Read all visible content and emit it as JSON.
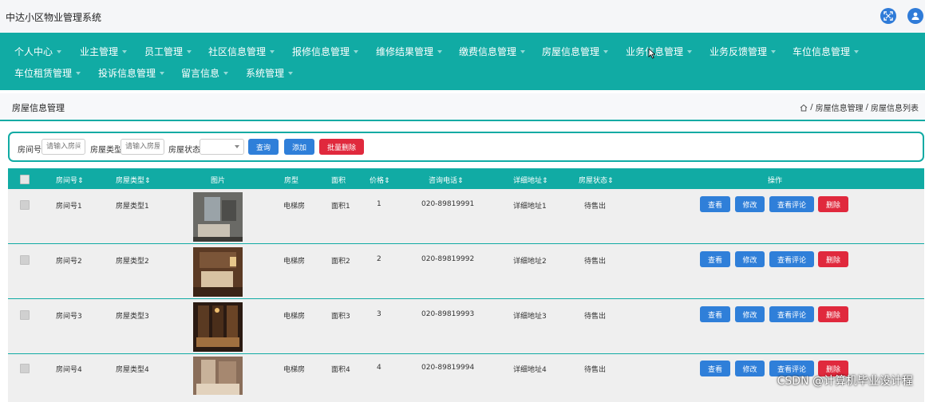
{
  "app": {
    "title": "中达小区物业管理系统"
  },
  "nav": {
    "row1": [
      "个人中心",
      "业主管理",
      "员工管理",
      "社区信息管理",
      "报修信息管理",
      "维修结果管理",
      "缴费信息管理",
      "房屋信息管理",
      "业务信息管理",
      "业务反馈管理",
      "车位信息管理"
    ],
    "row2": [
      "车位租赁管理",
      "投诉信息管理",
      "留言信息",
      "系统管理"
    ]
  },
  "page": {
    "title": "房屋信息管理",
    "breadcrumb": [
      "房屋信息管理",
      "房屋信息列表"
    ]
  },
  "search": {
    "room_label": "房间号",
    "room_placeholder": "请输入房间号",
    "type_label": "房屋类型",
    "type_placeholder": "请输入房屋类型",
    "status_label": "房屋状态",
    "query_btn": "查询",
    "add_btn": "添加",
    "batch_delete_btn": "批量删除"
  },
  "table": {
    "headers": [
      "房间号",
      "房屋类型",
      "图片",
      "房型",
      "面积",
      "价格",
      "咨询电话",
      "详细地址",
      "房屋状态",
      "操作"
    ],
    "sortable": [
      "房间号",
      "房屋类型",
      "价格",
      "咨询电话",
      "详细地址",
      "房屋状态"
    ],
    "rows": [
      {
        "room": "房间号1",
        "type": "房屋类型1",
        "layout": "电梯房",
        "area": "面积1",
        "price": "1",
        "phone": "020-89819991",
        "address": "详细地址1",
        "status": "待售出"
      },
      {
        "room": "房间号2",
        "type": "房屋类型2",
        "layout": "电梯房",
        "area": "面积2",
        "price": "2",
        "phone": "020-89819992",
        "address": "详细地址2",
        "status": "待售出"
      },
      {
        "room": "房间号3",
        "type": "房屋类型3",
        "layout": "电梯房",
        "area": "面积3",
        "price": "3",
        "phone": "020-89819993",
        "address": "详细地址3",
        "status": "待售出"
      },
      {
        "room": "房间号4",
        "type": "房屋类型4",
        "layout": "电梯房",
        "area": "面积4",
        "price": "4",
        "phone": "020-89819994",
        "address": "详细地址4",
        "status": "待售出"
      }
    ],
    "actions": [
      "查看",
      "修改",
      "查看评论",
      "删除"
    ]
  },
  "watermark": "CSDN @计算机毕业设计程",
  "colors": {
    "primary": "#11aba4",
    "button_blue": "#2f7fd9",
    "button_red": "#e0293d"
  }
}
